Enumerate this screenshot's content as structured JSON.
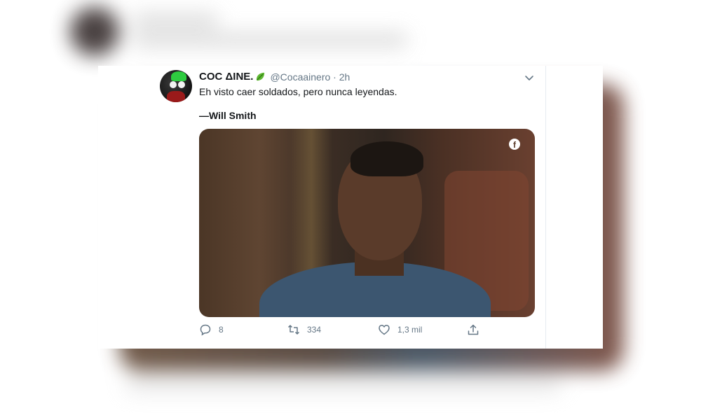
{
  "tweet": {
    "display_name": "COC ΔINE.",
    "handle_time": "@Cocaainero · 2h",
    "text": "Eh visto caer soldados, pero nunca leyendas.",
    "quote_author": "—Will Smith",
    "media_badge_icon": "facebook-icon",
    "name_emoji_icon": "leaf-icon",
    "actions": {
      "replies": "8",
      "retweets": "334",
      "likes": "1,3 mil"
    }
  },
  "colors": {
    "text_primary": "#14171a",
    "text_secondary": "#657786",
    "divider": "#e6ecf0",
    "card_bg": "#ffffff"
  }
}
